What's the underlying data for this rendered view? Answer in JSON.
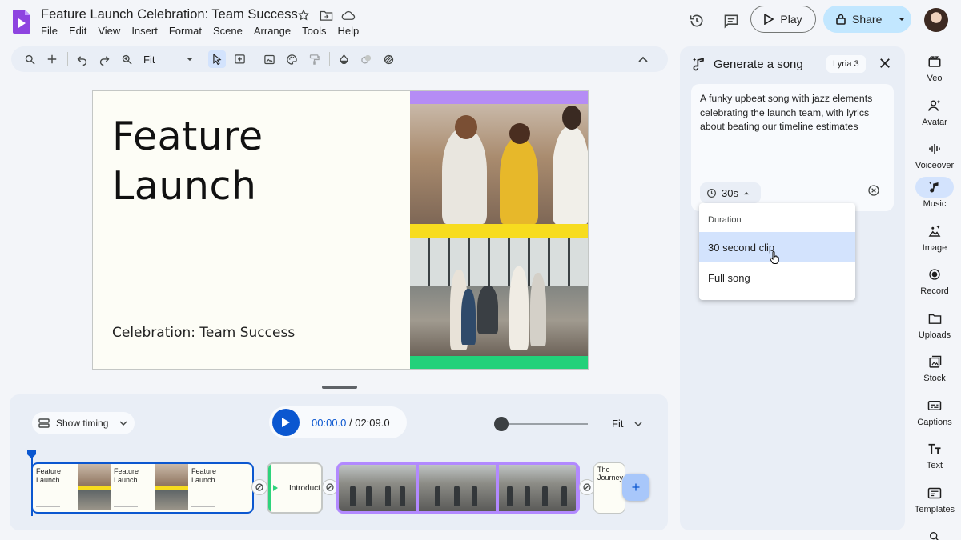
{
  "header": {
    "doc_title": "Feature Launch Celebration: Team Success",
    "menu": [
      "File",
      "Edit",
      "View",
      "Insert",
      "Format",
      "Scene",
      "Arrange",
      "Tools",
      "Help"
    ],
    "play_label": "Play",
    "share_label": "Share"
  },
  "toolbar": {
    "zoom_label": "Fit"
  },
  "slide": {
    "title_line1": "Feature",
    "title_line2": "Launch",
    "subtitle": "Celebration: Team Success",
    "strip_colors": {
      "top": "#b58cf5",
      "middle": "#f7dc1f",
      "bottom": "#22d17a"
    }
  },
  "timeline": {
    "show_timing_label": "Show timing",
    "current_time": "00:00.0",
    "time_separator": " / ",
    "total_time": "02:09.0",
    "fit_label": "Fit",
    "clips": {
      "scene1_title_line1": "Feature",
      "scene1_title_line2": "Launch",
      "intro_label": "Introduct",
      "journey_line1": "The",
      "journey_line2": "Journey"
    }
  },
  "song_panel": {
    "title": "Generate a song",
    "model_badge": "Lyria 3",
    "prompt": "A funky upbeat song with jazz elements celebrating the launch team, with lyrics about beating our timeline estimates",
    "duration_value": "30s",
    "dropdown": {
      "header": "Duration",
      "options": [
        "30 second clip",
        "Full song"
      ],
      "selected": "30 second clip"
    }
  },
  "rail": {
    "items": [
      {
        "label": "Veo",
        "icon": "veo-icon"
      },
      {
        "label": "Avatar",
        "icon": "avatar-icon"
      },
      {
        "label": "Voiceover",
        "icon": "voiceover-icon"
      },
      {
        "label": "Music",
        "icon": "music-icon",
        "active": true
      },
      {
        "label": "Image",
        "icon": "image-icon"
      },
      {
        "label": "Record",
        "icon": "record-icon"
      },
      {
        "label": "Uploads",
        "icon": "uploads-icon"
      },
      {
        "label": "Stock",
        "icon": "stock-icon"
      },
      {
        "label": "Captions",
        "icon": "captions-icon"
      },
      {
        "label": "Text",
        "icon": "text-icon"
      },
      {
        "label": "Templates",
        "icon": "templates-icon"
      }
    ]
  },
  "colors": {
    "accent": "#0b57d0",
    "share_bg": "#c2e7ff",
    "selection": "#d3e3fd"
  }
}
